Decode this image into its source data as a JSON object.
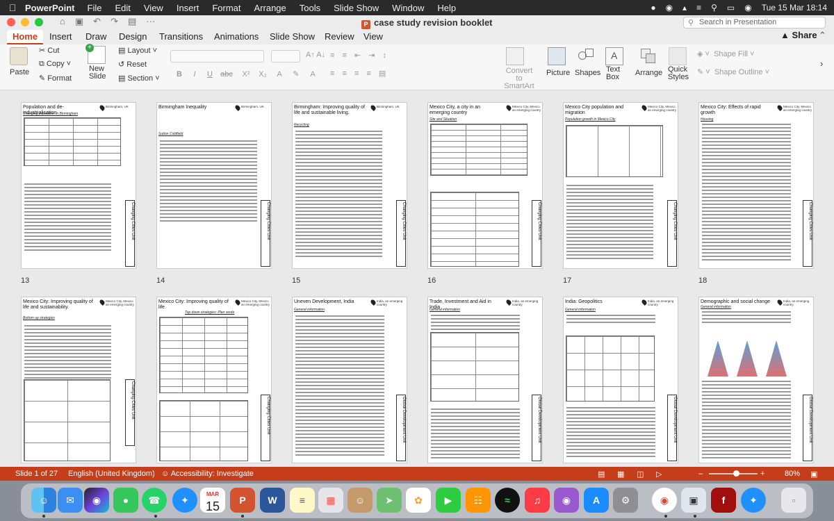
{
  "menubar": {
    "app_name": "PowerPoint",
    "items": [
      "File",
      "Edit",
      "View",
      "Insert",
      "Format",
      "Arrange",
      "Tools",
      "Slide Show",
      "Window",
      "Help"
    ],
    "clock": "Tue 15 Mar  18:14"
  },
  "window": {
    "doc_title": "case study revision booklet",
    "search_placeholder": "Search in Presentation",
    "tabs": [
      "Home",
      "Insert",
      "Draw",
      "Design",
      "Transitions",
      "Animations",
      "Slide Show",
      "Review",
      "View"
    ],
    "share_label": "Share"
  },
  "ribbon": {
    "paste": "Paste",
    "cut": "Cut",
    "copy": "Copy",
    "format": "Format",
    "new_slide": "New\nSlide",
    "layout": "Layout",
    "reset": "Reset",
    "section": "Section",
    "convert_smartart": "Convert to SmartArt",
    "picture": "Picture",
    "shapes": "Shapes",
    "text_box": "Text Box",
    "arrange": "Arrange",
    "quick_styles": "Quick Styles",
    "shape_fill": "Shape Fill",
    "shape_outline": "Shape Outline"
  },
  "slides": [
    {
      "num": "13",
      "title": "Population and de-industrialisation",
      "location": "Birmingham, UK",
      "sub": "Changing population in Birmingham",
      "unit": "Changing Cities Unit"
    },
    {
      "num": "14",
      "title": "Birmingham Inequality",
      "location": "Birmingham, UK",
      "sub": "Sutton Coldfield",
      "unit": "Changing Cities Unit"
    },
    {
      "num": "15",
      "title": "Birmingham: Improving quality of life and sustainable living.",
      "location": "Birmingham, UK",
      "sub": "Recycling",
      "unit": "Changing Cities Unit"
    },
    {
      "num": "16",
      "title": "Mexico City, a city in an emerging country",
      "location": "Mexico City, Mexico an emerging country",
      "sub": "Site and Situation",
      "unit": "Changing Cities Unit"
    },
    {
      "num": "17",
      "title": "Mexico City population and migration",
      "location": "Mexico City, Mexico an emerging country",
      "sub": "Population growth in Mexico City",
      "unit": "Changing Cities Unit"
    },
    {
      "num": "18",
      "title": "Mexico City: Effects of rapid growth",
      "location": "Mexico City, Mexico an emerging country",
      "sub": "Housing",
      "unit": "Changing Cities Unit"
    },
    {
      "num": "19",
      "title": "Mexico City: Improving quality of life and sustainability.",
      "location": "Mexico City, Mexico an emerging country",
      "sub": "Bottom up strategies",
      "unit": "Changing Cities Unit"
    },
    {
      "num": "20",
      "title": "Mexico City: Improving quality of life",
      "location": "Mexico City, Mexico an emerging country",
      "sub": "Top down strategies: Plan verde",
      "unit": "Changing Cities Unit"
    },
    {
      "num": "21",
      "title": "Uneven Development, India",
      "location": "India, an emerging country",
      "sub": "General information",
      "unit": "Global Development Unit"
    },
    {
      "num": "22",
      "title": "Trade, Investment and Aid in India",
      "location": "India, an emerging country",
      "sub": "General information",
      "unit": "Global Development Unit"
    },
    {
      "num": "23",
      "title": "India: Geopolitics",
      "location": "India, an emerging country",
      "sub": "General information",
      "unit": "Global Development Unit"
    },
    {
      "num": "24",
      "title": "Demographic and social change",
      "location": "India, an emerging country",
      "sub": "General information",
      "unit": "Global Development Unit"
    }
  ],
  "statusbar": {
    "slide_count": "Slide 1 of 27",
    "language": "English (United Kingdom)",
    "accessibility": "Accessibility: Investigate",
    "zoom": "80%"
  },
  "dock": [
    "finder-icon",
    "mail-icon",
    "siri-icon",
    "messages-icon",
    "whatsapp-icon",
    "safari-icon",
    "calendar-icon",
    "powerpoint-icon",
    "word-icon",
    "notes-icon",
    "launchpad-icon",
    "contacts-icon",
    "maps-icon",
    "photos-icon",
    "facetime-icon",
    "books-icon",
    "spotify-icon",
    "music-icon",
    "podcasts-icon",
    "appstore-icon",
    "settings-icon",
    "chrome-icon",
    "preview-icon",
    "flash-icon",
    "safari2-icon",
    "trash-icon"
  ],
  "calendar_date": {
    "month": "MAR",
    "day": "15"
  }
}
